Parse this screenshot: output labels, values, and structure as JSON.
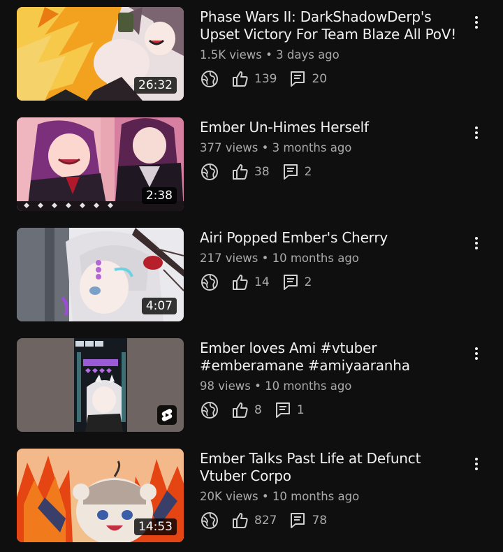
{
  "videos": [
    {
      "title": "Phase Wars II: DarkShadowDerp's Upset Victory For Team Blaze All PoV!",
      "views": "1.5K views",
      "age": "3 days ago",
      "likes": "139",
      "comments": "20",
      "duration": "26:32"
    },
    {
      "title": "Ember Un-Himes Herself",
      "views": "377 views",
      "age": "3 months ago",
      "likes": "38",
      "comments": "2",
      "duration": "2:38"
    },
    {
      "title": "Airi Popped Ember's Cherry",
      "views": "217 views",
      "age": "10 months ago",
      "likes": "14",
      "comments": "2",
      "duration": "4:07"
    },
    {
      "title": "Ember loves Ami #vtuber #emberamane #amiyaaranha",
      "views": "98 views",
      "age": "10 months ago",
      "likes": "8",
      "comments": "1",
      "duration": ""
    },
    {
      "title": "Ember Talks Past Life at Defunct Vtuber Corpo",
      "views": "20K views",
      "age": "10 months ago",
      "likes": "827",
      "comments": "78",
      "duration": "14:53"
    }
  ],
  "separator": "•",
  "icons": {
    "visibility": "globe-icon",
    "likes": "thumbs-up-icon",
    "comments": "comment-icon",
    "menu": "more-vert-icon",
    "shorts": "shorts-icon"
  },
  "colors": {
    "background": "#0f0f0f",
    "text": "#f1f1f1",
    "secondary": "#aaaaaa"
  }
}
